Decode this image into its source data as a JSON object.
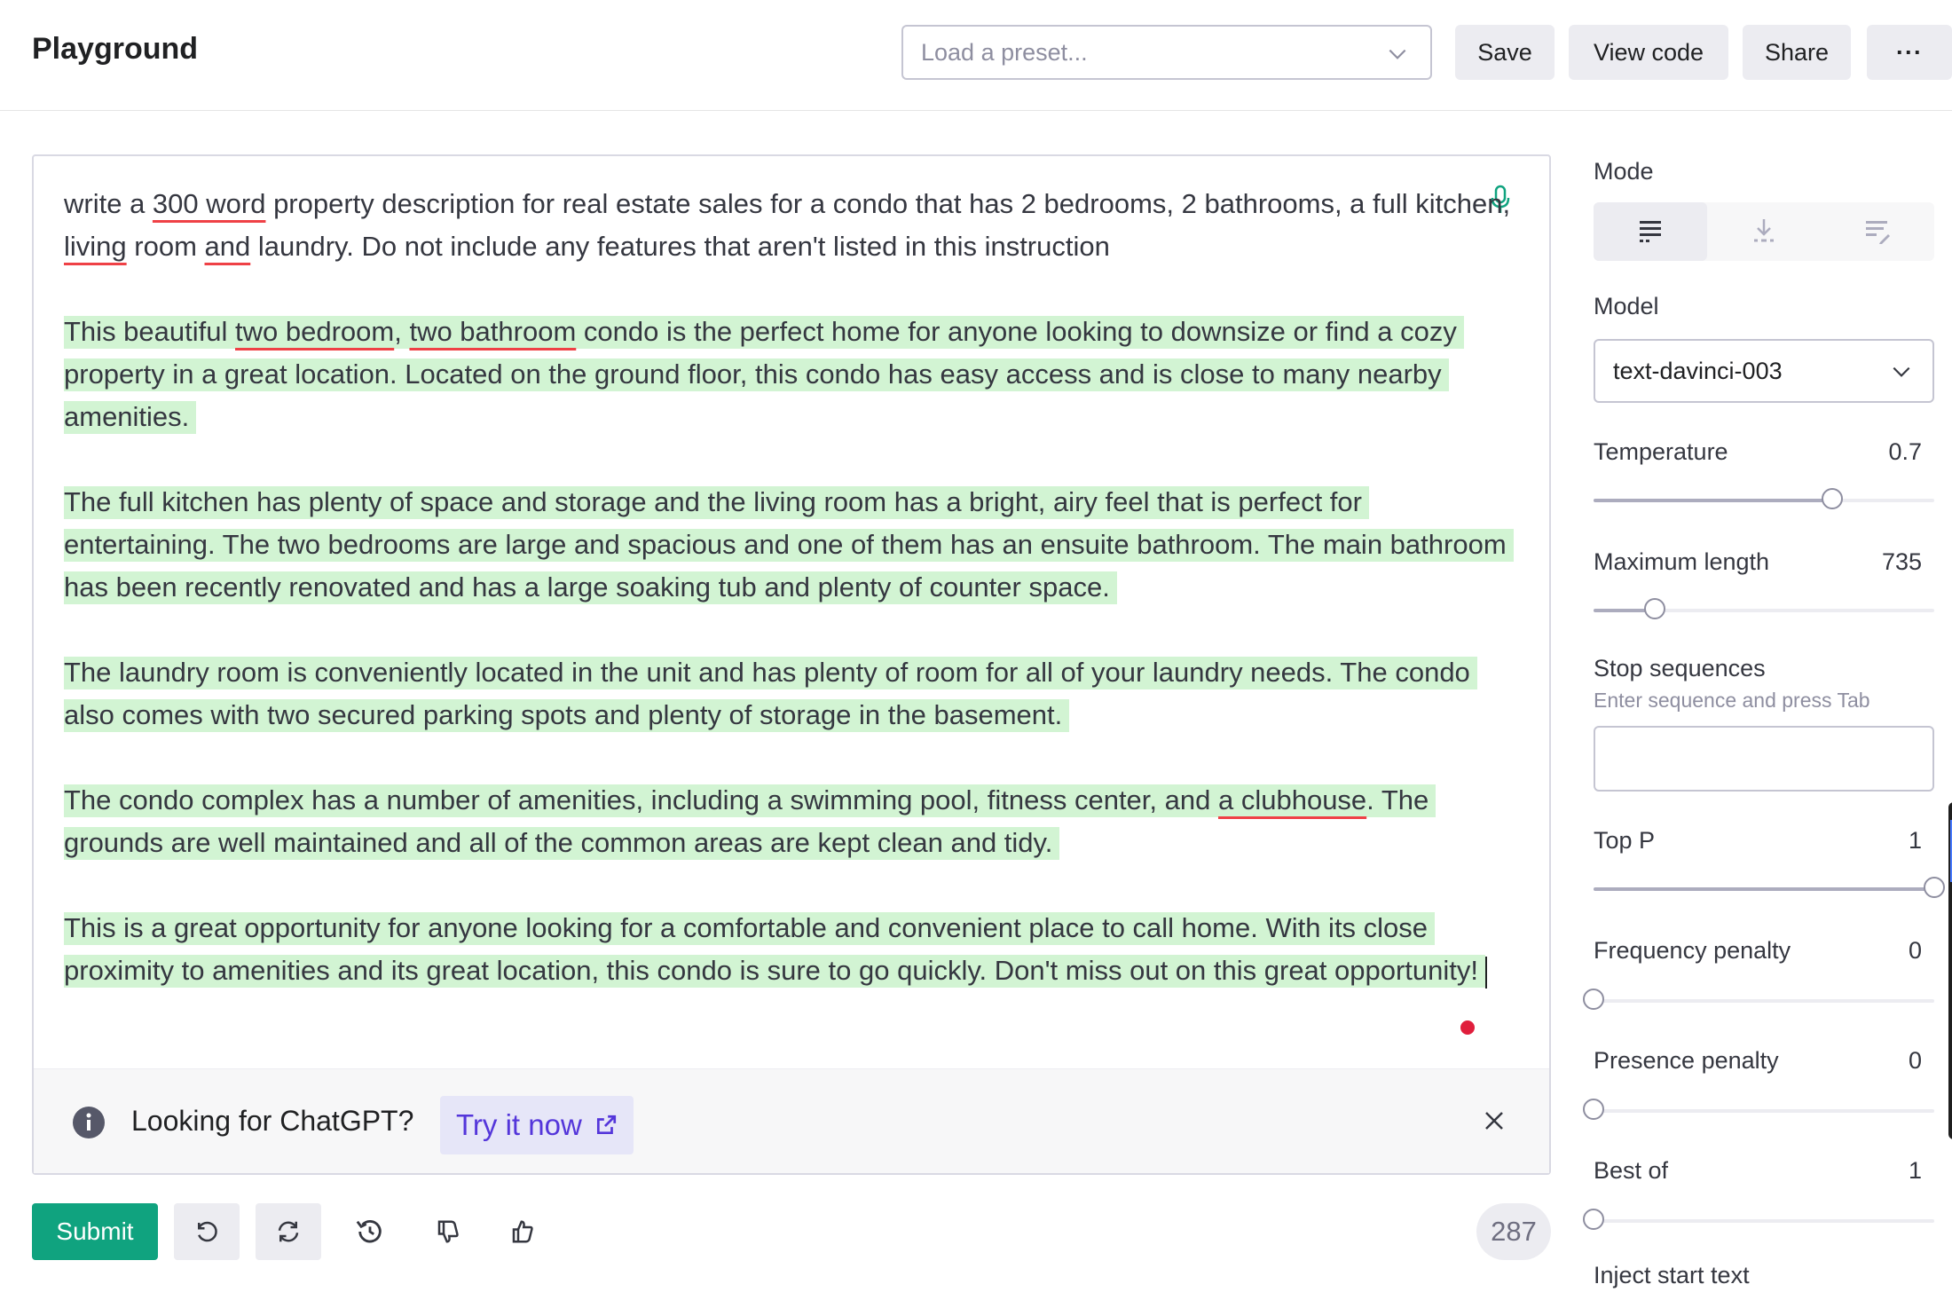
{
  "header": {
    "title": "Playground",
    "preset_placeholder": "Load a preset...",
    "save_label": "Save",
    "view_code_label": "View code",
    "share_label": "Share",
    "more_label": "···"
  },
  "editor": {
    "prompt_parts": [
      "write a ",
      "300 word",
      " property description for real estate sales for a condo that has 2 bedrooms, 2 bathrooms, a full kitchen, ",
      "living",
      " room ",
      "and",
      " laundry. Do not include any features that aren't listed in this instruction"
    ],
    "p1_parts": [
      "This beautiful ",
      "two bedroom",
      ", ",
      "two bathroom",
      " condo is the perfect home for anyone looking to downsize or find a cozy property in a great location. Located on the ground floor, this condo has easy access and is close to many nearby amenities."
    ],
    "p2": "The full kitchen has plenty of space and storage and the living room has a bright, airy feel that is perfect for entertaining. The two bedrooms are large and spacious and one of them has an ensuite bathroom. The main bathroom has been recently renovated and has a large soaking tub and plenty of counter space.",
    "p3": "The laundry room is conveniently located in the unit and has plenty of room for all of your laundry needs. The condo also comes with two secured parking spots and plenty of storage in the basement.",
    "p4_parts": [
      "The condo complex has a number of amenities, including a swimming pool, fitness center, and ",
      "a clubhouse",
      ". The grounds are well maintained and all of the common areas are kept clean and tidy."
    ],
    "p5": "This is a great opportunity for anyone looking for a comfortable and convenient place to call home. With its close proximity to amenities and its great location, this condo is sure to go quickly. Don't miss out on this great opportunity!"
  },
  "banner": {
    "text": "Looking for ChatGPT?",
    "link": "Try it now"
  },
  "footer": {
    "submit_label": "Submit",
    "token_count": "287"
  },
  "settings": {
    "mode_label": "Mode",
    "mode_selected": "complete",
    "model_label": "Model",
    "model_value": "text-davinci-003",
    "temperature": {
      "label": "Temperature",
      "value": "0.7",
      "fraction": 0.7
    },
    "max_length": {
      "label": "Maximum length",
      "value": "735",
      "fraction": 0.18
    },
    "stop_sequences": {
      "label": "Stop sequences",
      "hint": "Enter sequence and press Tab"
    },
    "top_p": {
      "label": "Top P",
      "value": "1",
      "fraction": 1.0
    },
    "frequency_penalty": {
      "label": "Frequency penalty",
      "value": "0",
      "fraction": 0
    },
    "presence_penalty": {
      "label": "Presence penalty",
      "value": "0",
      "fraction": 0
    },
    "best_of": {
      "label": "Best of",
      "value": "1",
      "fraction": 0
    },
    "inject_start_label": "Inject start text"
  },
  "colors": {
    "accent": "#10a37f",
    "highlight": "#d2f4d3",
    "link": "#5436da",
    "spellcheck": "#ef4146"
  }
}
